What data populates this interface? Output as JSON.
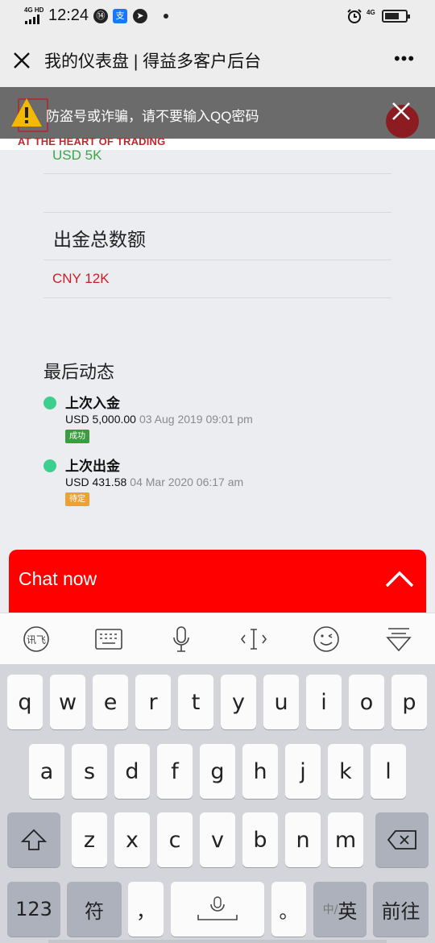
{
  "status_bar": {
    "network_top": "4G HD",
    "time": "12:24",
    "right_network": "4G"
  },
  "title_bar": {
    "title": "我的仪表盘 | 得益多客户后台",
    "more_label": "•••"
  },
  "warning": {
    "text": "防盗号或诈骗，请不要输入QQ密码"
  },
  "brand": {
    "tagline": "AT THE HEART OF TRADING"
  },
  "main": {
    "partial_deposit_value": "USD 5K",
    "withdrawal_title": "出金总数额",
    "withdrawal_value": "CNY 12K",
    "recent_title": "最后动态",
    "activities": [
      {
        "title": "上次入金",
        "amount": "USD 5,000.00",
        "date": "03 Aug 2019 09:01 pm",
        "status": "成功",
        "status_color": "#3a9d3f"
      },
      {
        "title": "上次出金",
        "amount": "USD 431.58",
        "date": "04 Mar 2020 06:17 am",
        "status": "待定",
        "status_color": "#f0a030"
      }
    ]
  },
  "chat": {
    "label": "Chat now",
    "color": "#ff0000"
  },
  "keyboard": {
    "row1": [
      "q",
      "w",
      "e",
      "r",
      "t",
      "y",
      "u",
      "i",
      "o",
      "p"
    ],
    "row2": [
      "a",
      "s",
      "d",
      "f",
      "g",
      "h",
      "j",
      "k",
      "l"
    ],
    "row3": [
      "z",
      "x",
      "c",
      "v",
      "b",
      "n",
      "m"
    ],
    "bottom": {
      "num": "123",
      "symbol": "符",
      "comma": "，",
      "period": "。",
      "lang_small": "中/",
      "lang_big": "英",
      "go": "前往"
    }
  }
}
